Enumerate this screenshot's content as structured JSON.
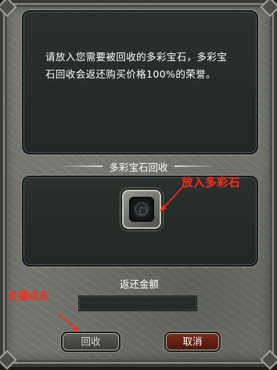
{
  "dialog": {
    "description": "请放入您需要被回收的多彩宝石，多彩宝石回收会返还购买价格100%的荣誉。",
    "section_title": "多彩宝石回收",
    "amount_label": "返还金额",
    "amount_value": "",
    "recycle_button": "回收",
    "cancel_button": "取消"
  },
  "annotations": {
    "place_gem": "放入多彩石",
    "left_click": "左键点击"
  },
  "colors": {
    "annotation": "#ff2a1a",
    "cancel_button": "#6a2214"
  }
}
